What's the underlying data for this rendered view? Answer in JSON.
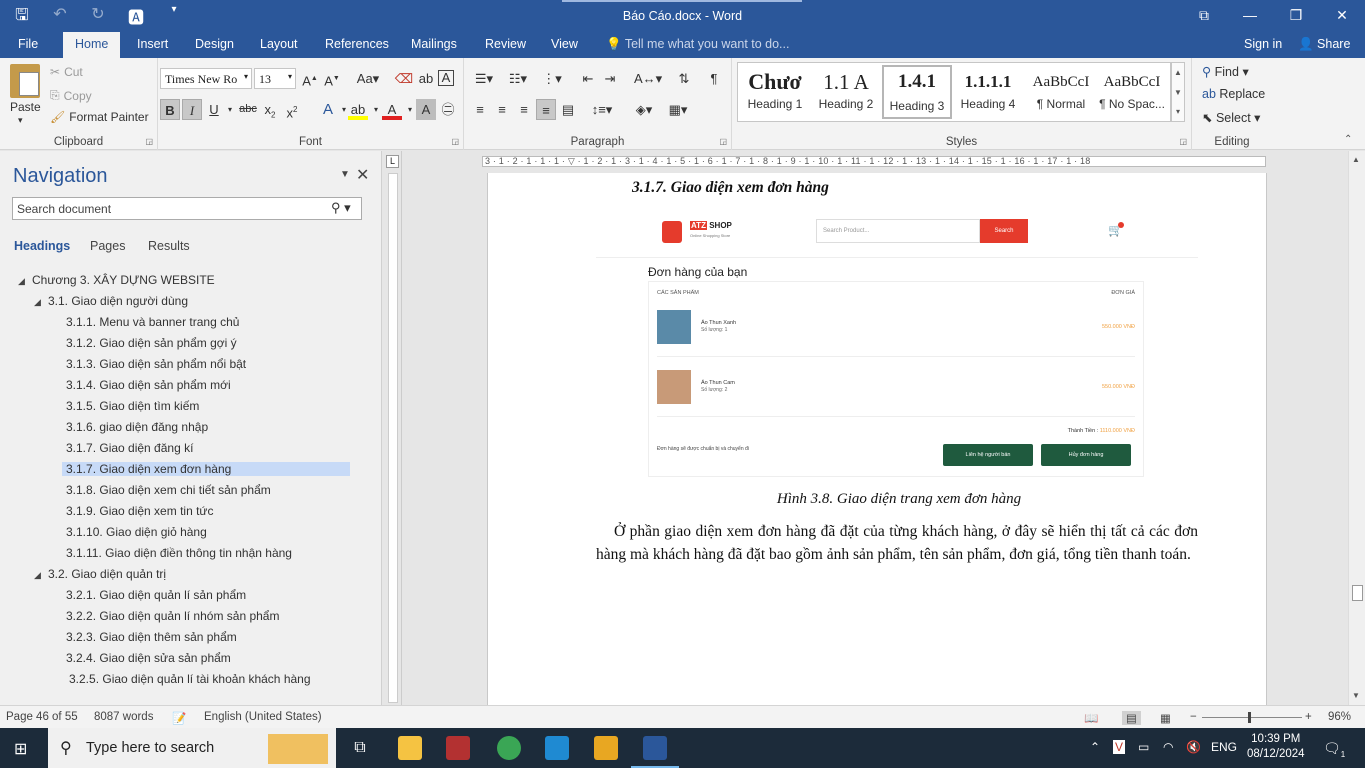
{
  "window": {
    "title": "Báo Cáo.docx - Word"
  },
  "tabs": [
    "File",
    "Home",
    "Insert",
    "Design",
    "Layout",
    "References",
    "Mailings",
    "Review",
    "View"
  ],
  "tell_me": "Tell me what you want to do...",
  "sign_in": "Sign in",
  "share": "Share",
  "clipboard": {
    "paste": "Paste",
    "cut": "Cut",
    "copy": "Copy",
    "format_painter": "Format Painter",
    "label": "Clipboard"
  },
  "font": {
    "name": "Times New Ro",
    "size": "13",
    "label": "Font"
  },
  "paragraph": {
    "label": "Paragraph"
  },
  "styles": {
    "label": "Styles",
    "items": [
      {
        "preview": "Chươ",
        "name": "Heading 1"
      },
      {
        "preview": "1.1",
        "name": "Heading 2"
      },
      {
        "preview": "1.4.1",
        "name": "Heading 3"
      },
      {
        "preview": "1.1.1.1",
        "name": "Heading 4"
      },
      {
        "preview": "AaBbCcI",
        "name": "¶ Normal"
      },
      {
        "preview": "AaBbCcI",
        "name": "¶ No Spac..."
      }
    ]
  },
  "editing": {
    "find": "Find",
    "replace": "Replace",
    "select": "Select",
    "label": "Editing"
  },
  "navigation": {
    "title": "Navigation",
    "search_placeholder": "Search document",
    "tabs": [
      "Headings",
      "Pages",
      "Results"
    ],
    "headings": [
      {
        "text": "Chương 3. XÂY DỰNG WEBSITE",
        "level": 1,
        "expanded": true
      },
      {
        "text": "3.1. Giao diện người dùng",
        "level": 2,
        "expanded": true
      },
      {
        "text": "3.1.1. Menu và banner trang chủ",
        "level": 3
      },
      {
        "text": "3.1.2. Giao diện sản phẩm gợi ý",
        "level": 3
      },
      {
        "text": "3.1.3. Giao diện sản phẩm nổi bật",
        "level": 3
      },
      {
        "text": "3.1.4. Giao diện sản phẩm mới",
        "level": 3
      },
      {
        "text": "3.1.5. Giao diện tìm kiếm",
        "level": 3
      },
      {
        "text": "3.1.6. giao diện đăng nhập",
        "level": 3
      },
      {
        "text": "3.1.7. Giao diện đăng kí",
        "level": 3
      },
      {
        "text": "3.1.7. Giao diện xem đơn hàng",
        "level": 3,
        "selected": true
      },
      {
        "text": "3.1.8. Giao diện xem chi tiết sản phẩm",
        "level": 3
      },
      {
        "text": "3.1.9. Giao diện xem tin tức",
        "level": 3
      },
      {
        "text": "3.1.10. Giao diện giỏ hàng",
        "level": 3
      },
      {
        "text": "3.1.11. Giao diện điền thông tin nhận hàng",
        "level": 3
      },
      {
        "text": "3.2. Giao diện quản trị",
        "level": 2,
        "expanded": true
      },
      {
        "text": "3.2.1. Giao diện quản lí sản phẩm",
        "level": 3
      },
      {
        "text": "3.2.2. Giao diện quản lí nhóm sản phẩm",
        "level": 3
      },
      {
        "text": "3.2.3. Giao diện thêm sản phẩm",
        "level": 3
      },
      {
        "text": "3.2.4. Giao diện sửa sản phẩm",
        "level": 3
      },
      {
        "text": "3.2.5. Giao diện quản lí tài khoản khách hàng",
        "level": 3
      }
    ]
  },
  "ruler_text": "3 · 1 · 2 · 1 · 1 · 1 · ▽ · 1 · 2 · 1 · 3 · 1 · 4 · 1 · 5 · 1 · 6 · 1 · 7 · 1 · 8 · 1 · 9 · 1 · 10 · 1 · 11 · 1 · 12 · 1 · 13 · 1 · 14 · 1 · 15 · 1 · 16 · 1 · 17 · 1 · 18",
  "document": {
    "heading": "3.1.7. Giao diện xem đơn hàng",
    "caption": "Hình 3.8. Giao diện trang xem đơn hàng",
    "paragraph": "Ở phần giao diện xem đơn hàng đã đặt của từng khách hàng, ở đây sẽ hiển thị tất cả các đơn hàng mà khách hàng đã đặt bao gồm ảnh sản phẩm, tên sản phẩm, đơn giá, tổng tiền thanh toán."
  },
  "embedded_shop": {
    "logo_brand": "ATZ",
    "logo_text": "SHOP",
    "logo_sub": "Online Shopping Store",
    "search_placeholder": "Search Product...",
    "search_button": "Search",
    "orders_title": "Đơn hàng của bạn",
    "col_products": "CÁC SẢN PHẨM",
    "col_price": "ĐƠN GIÁ",
    "items": [
      {
        "name": "Áo Thun Xanh",
        "qty": "Số lượng: 1",
        "price": "550.000 VNĐ"
      },
      {
        "name": "Áo Thun Cam",
        "qty": "Số lượng: 2",
        "price": "550.000 VNĐ"
      }
    ],
    "total_label": "Thành Tiền :",
    "total_value": "1110.000 VNĐ",
    "note": "Đơn hàng sẽ được chuẩn bị và chuyển đi",
    "btn_contact": "Liên hệ người bán",
    "btn_cancel": "Hủy đơn hàng"
  },
  "status": {
    "page": "Page 46 of 55",
    "words": "8087 words",
    "language": "English (United States)",
    "zoom": "96%"
  },
  "taskbar": {
    "search": "Type here to search",
    "lang": "ENG",
    "time": "10:39 PM",
    "date": "08/12/2024",
    "notifications": "1"
  }
}
